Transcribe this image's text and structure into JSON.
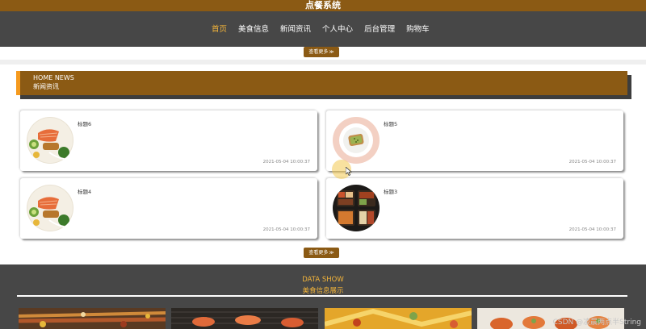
{
  "header": {
    "site_title": "点餐系统"
  },
  "nav": {
    "items": [
      {
        "label": "首页",
        "active": true
      },
      {
        "label": "美食信息"
      },
      {
        "label": "新闻资讯"
      },
      {
        "label": "个人中心"
      },
      {
        "label": "后台管理"
      },
      {
        "label": "购物车"
      }
    ]
  },
  "buttons": {
    "view_more": "查看更多",
    "arrow": "≫"
  },
  "news": {
    "title_en": "HOME NEWS",
    "title_cn": "新闻资讯",
    "items": [
      {
        "title": "标题6",
        "date": "2021-05-04 10:00:37",
        "image": "salmon-platter"
      },
      {
        "title": "标题5",
        "date": "2021-05-04 10:00:37",
        "image": "avocado-toast"
      },
      {
        "title": "标题4",
        "date": "2021-05-04 10:00:37",
        "image": "salmon-platter"
      },
      {
        "title": "标题3",
        "date": "2021-05-04 10:00:37",
        "image": "bento-box"
      }
    ]
  },
  "data_show": {
    "title_en": "DATA SHOW",
    "title_cn": "美食信息展示",
    "images": [
      "grilled-skewers",
      "shrimp-grill",
      "seafood-plate",
      "stuffed-peppers"
    ]
  },
  "watermark": "CSDN @凌晨两点半String",
  "colors": {
    "brand": "#8b5a14",
    "accent": "#f3b43a",
    "dark": "#474747"
  }
}
